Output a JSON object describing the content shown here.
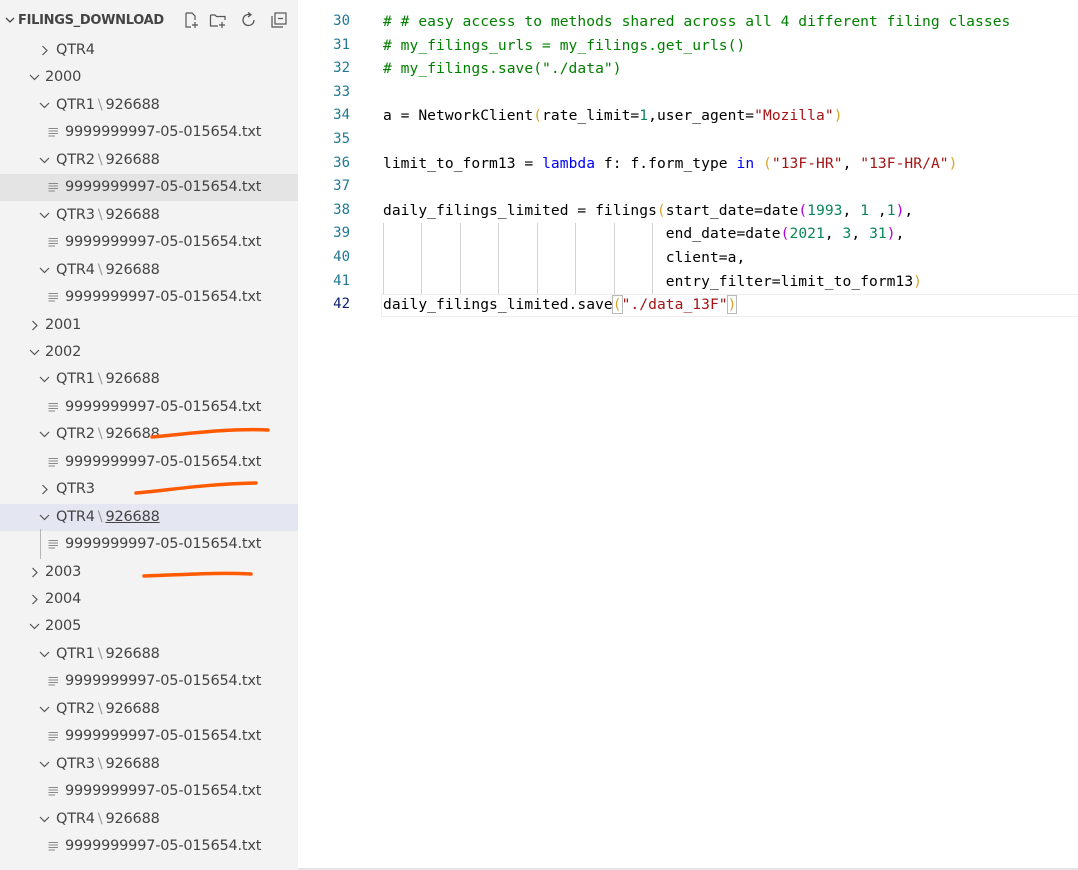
{
  "explorer": {
    "title": "FILINGS_DOWNLOAD",
    "actions": [
      "new-file-icon",
      "new-folder-icon",
      "refresh-icon",
      "collapse-all-icon"
    ],
    "tree": [
      {
        "depth": 1,
        "type": "folder",
        "expanded": false,
        "label": "QTR4"
      },
      {
        "depth": 0,
        "type": "folder",
        "expanded": true,
        "label": "2000"
      },
      {
        "depth": 1,
        "type": "folder",
        "expanded": true,
        "label": "QTR1",
        "sub": "926688"
      },
      {
        "depth": 2,
        "type": "file",
        "label": "9999999997-05-015654.txt"
      },
      {
        "depth": 1,
        "type": "folder",
        "expanded": true,
        "label": "QTR2",
        "sub": "926688"
      },
      {
        "depth": 2,
        "type": "file",
        "label": "9999999997-05-015654.txt",
        "state": "selected"
      },
      {
        "depth": 1,
        "type": "folder",
        "expanded": true,
        "label": "QTR3",
        "sub": "926688"
      },
      {
        "depth": 2,
        "type": "file",
        "label": "9999999997-05-015654.txt"
      },
      {
        "depth": 1,
        "type": "folder",
        "expanded": true,
        "label": "QTR4",
        "sub": "926688"
      },
      {
        "depth": 2,
        "type": "file",
        "label": "9999999997-05-015654.txt"
      },
      {
        "depth": 0,
        "type": "folder",
        "expanded": false,
        "label": "2001"
      },
      {
        "depth": 0,
        "type": "folder",
        "expanded": true,
        "label": "2002"
      },
      {
        "depth": 1,
        "type": "folder",
        "expanded": true,
        "label": "QTR1",
        "sub": "926688"
      },
      {
        "depth": 2,
        "type": "file",
        "label": "9999999997-05-015654.txt"
      },
      {
        "depth": 1,
        "type": "folder",
        "expanded": true,
        "label": "QTR2",
        "sub": "926688"
      },
      {
        "depth": 2,
        "type": "file",
        "label": "9999999997-05-015654.txt"
      },
      {
        "depth": 1,
        "type": "folder",
        "expanded": false,
        "label": "QTR3"
      },
      {
        "depth": 1,
        "type": "folder",
        "expanded": true,
        "label": "QTR4",
        "sub": "926688",
        "state": "focused",
        "subUnderline": true
      },
      {
        "depth": 2,
        "type": "file",
        "label": "9999999997-05-015654.txt"
      },
      {
        "depth": 0,
        "type": "folder",
        "expanded": false,
        "label": "2003"
      },
      {
        "depth": 0,
        "type": "folder",
        "expanded": false,
        "label": "2004"
      },
      {
        "depth": 0,
        "type": "folder",
        "expanded": true,
        "label": "2005"
      },
      {
        "depth": 1,
        "type": "folder",
        "expanded": true,
        "label": "QTR1",
        "sub": "926688"
      },
      {
        "depth": 2,
        "type": "file",
        "label": "9999999997-05-015654.txt"
      },
      {
        "depth": 1,
        "type": "folder",
        "expanded": true,
        "label": "QTR2",
        "sub": "926688"
      },
      {
        "depth": 2,
        "type": "file",
        "label": "9999999997-05-015654.txt"
      },
      {
        "depth": 1,
        "type": "folder",
        "expanded": true,
        "label": "QTR3",
        "sub": "926688"
      },
      {
        "depth": 2,
        "type": "file",
        "label": "9999999997-05-015654.txt"
      },
      {
        "depth": 1,
        "type": "folder",
        "expanded": true,
        "label": "QTR4",
        "sub": "926688"
      },
      {
        "depth": 2,
        "type": "file",
        "label": "9999999997-05-015654.txt"
      }
    ]
  },
  "editor": {
    "active_line": 42,
    "lines": [
      {
        "n": 30,
        "tokens": [
          [
            "c",
            "# # easy access to methods shared across all 4 different filing classes"
          ]
        ]
      },
      {
        "n": 31,
        "tokens": [
          [
            "c",
            "# my_filings_urls = my_filings.get_urls()"
          ]
        ]
      },
      {
        "n": 32,
        "tokens": [
          [
            "c",
            "# my_filings.save(\"./data\")"
          ]
        ]
      },
      {
        "n": 33,
        "tokens": []
      },
      {
        "n": 34,
        "tokens": [
          [
            "",
            "a = NetworkClient"
          ],
          [
            "p",
            "("
          ],
          [
            "",
            "rate_limit="
          ],
          [
            "n",
            "1"
          ],
          [
            "",
            ",user_agent="
          ],
          [
            "s",
            "\"Mozilla\""
          ],
          [
            "p",
            ")"
          ]
        ]
      },
      {
        "n": 35,
        "tokens": []
      },
      {
        "n": 36,
        "tokens": [
          [
            "",
            "limit_to_form13 = "
          ],
          [
            "k",
            "lambda"
          ],
          [
            "",
            " f: f.form_type "
          ],
          [
            "k",
            "in"
          ],
          [
            "",
            " "
          ],
          [
            "p",
            "("
          ],
          [
            "s",
            "\"13F-HR\""
          ],
          [
            "",
            ", "
          ],
          [
            "s",
            "\"13F-HR/A\""
          ],
          [
            "p",
            ")"
          ]
        ]
      },
      {
        "n": 37,
        "tokens": []
      },
      {
        "n": 38,
        "tokens": [
          [
            "",
            "daily_filings_limited = filings"
          ],
          [
            "p",
            "("
          ],
          [
            "",
            "start_date=date"
          ],
          [
            "pm",
            "("
          ],
          [
            "n",
            "1993"
          ],
          [
            "",
            ", "
          ],
          [
            "n",
            "1"
          ],
          [
            "",
            " ,"
          ],
          [
            "n",
            "1"
          ],
          [
            "pm",
            ")"
          ],
          [
            "",
            ","
          ]
        ]
      },
      {
        "n": 39,
        "tokens": [
          [
            "",
            "                                end_date=date"
          ],
          [
            "pm",
            "("
          ],
          [
            "n",
            "2021"
          ],
          [
            "",
            ", "
          ],
          [
            "n",
            "3"
          ],
          [
            "",
            ", "
          ],
          [
            "n",
            "31"
          ],
          [
            "pm",
            ")"
          ],
          [
            "",
            ","
          ]
        ]
      },
      {
        "n": 40,
        "tokens": [
          [
            "",
            "                                client=a,"
          ]
        ]
      },
      {
        "n": 41,
        "tokens": [
          [
            "",
            "                                entry_filter=limit_to_form13"
          ],
          [
            "p",
            ")"
          ]
        ]
      },
      {
        "n": 42,
        "tokens": [
          [
            "",
            "daily_filings_limited.save"
          ],
          [
            "pbm",
            "("
          ],
          [
            "s",
            "\"./data_13F\""
          ],
          [
            "pbm",
            ")"
          ]
        ]
      }
    ]
  },
  "colors": {
    "sidebar_bg": "#f3f3f3",
    "selected_row": "#e4e4e4",
    "focused_row": "#e4e6f1",
    "annotation": "#ff5a00"
  }
}
